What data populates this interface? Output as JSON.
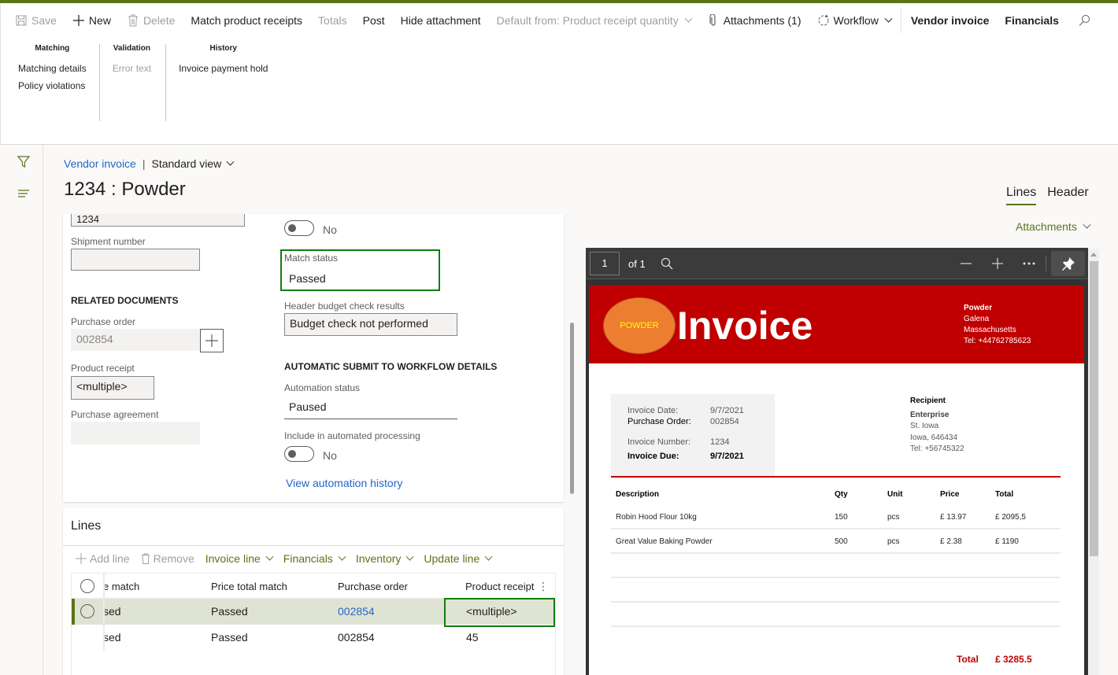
{
  "colors": {
    "accent": "#5b7418",
    "link": "#2266c9",
    "highlight": "#107c10",
    "invoice_red": "#c00000",
    "logo_orange": "#ed7d31",
    "logo_text": "#ffff00"
  },
  "toolbar": {
    "save": "Save",
    "new": "New",
    "delete": "Delete",
    "match_product_receipts": "Match product receipts",
    "totals": "Totals",
    "post": "Post",
    "hide_attachment": "Hide attachment",
    "default_from": "Default from: Product receipt quantity",
    "attachments": "Attachments (1)",
    "workflow": "Workflow",
    "vendor_invoice": "Vendor invoice",
    "financials": "Financials"
  },
  "action_groups": [
    {
      "title": "Matching",
      "items": [
        "Matching details",
        "Policy violations"
      ]
    },
    {
      "title": "Validation",
      "items": [
        "Error text"
      ]
    },
    {
      "title": "History",
      "items": [
        "Invoice payment hold"
      ]
    }
  ],
  "breadcrumb": {
    "link": "Vendor invoice",
    "separator": "|",
    "view": "Standard view"
  },
  "page_title": "1234 : Powder",
  "right_tabs": {
    "lines": "Lines",
    "header": "Header"
  },
  "header_form": {
    "top_field_value": "1234",
    "top_toggle_text": "No",
    "shipment_number_label": "Shipment number",
    "shipment_number_value": "",
    "related_documents_title": "RELATED DOCUMENTS",
    "purchase_order_label": "Purchase order",
    "purchase_order_value": "002854",
    "product_receipt_label": "Product receipt",
    "product_receipt_value": "<multiple>",
    "purchase_agreement_label": "Purchase agreement",
    "purchase_agreement_value": "",
    "match_status_label": "Match status",
    "match_status_value": "Passed",
    "budget_label": "Header budget check results",
    "budget_value": "Budget check not performed",
    "auto_submit_title": "AUTOMATIC SUBMIT TO WORKFLOW DETAILS",
    "automation_status_label": "Automation status",
    "automation_status_value": "Paused",
    "include_auto_label": "Include in automated processing",
    "include_auto_toggle_text": "No",
    "view_history_link": "View automation history"
  },
  "lines": {
    "title": "Lines",
    "commands": {
      "add_line": "Add line",
      "remove": "Remove",
      "invoice_line": "Invoice line",
      "financials": "Financials",
      "inventory": "Inventory",
      "update_line": "Update line"
    },
    "columns": [
      "e match",
      "Price total match",
      "Purchase order",
      "Product receipt"
    ],
    "rows": [
      {
        "c0": "sed",
        "c1": "Passed",
        "c2": "002854",
        "c3": "<multiple>",
        "selected": true
      },
      {
        "c0": "sed",
        "c1": "Passed",
        "c2": "002854",
        "c3": "45",
        "selected": false
      }
    ]
  },
  "attachments_dropdown": "Attachments",
  "pdf": {
    "page": "1",
    "of": "of 1",
    "invoice": {
      "logo_text": "POWDER",
      "title": "Invoice",
      "sender": {
        "name": "Powder",
        "city": "Galena",
        "state": "Massachusetts",
        "tel": "Tel: +44762785623"
      },
      "meta": [
        {
          "key": "Invoice Date:",
          "value": "9/7/2021"
        },
        {
          "key": "Purchase Order:",
          "value": "002854"
        },
        {
          "key": "Invoice Number:",
          "value": "1234"
        },
        {
          "key": "Invoice Due:",
          "value": "9/7/2021"
        }
      ],
      "recipient": {
        "heading": "Recipient",
        "name": "Enterprise",
        "street": "St. Iowa",
        "city": "Iowa, 646434",
        "tel": "Tel: +56745322"
      },
      "table_headers": [
        "Description",
        "Qty",
        "Unit",
        "Price",
        "Total"
      ],
      "items": [
        {
          "description": "Robin Hood Flour 10kg",
          "qty": "150",
          "unit": "pcs",
          "price": "£ 13.97",
          "total": "£ 2095,5"
        },
        {
          "description": "Great Value Baking Powder",
          "qty": "500",
          "unit": "pcs",
          "price": "£ 2.38",
          "total": "£ 1190"
        }
      ],
      "total_label": "Total",
      "total_value": "£ 3285.5"
    }
  }
}
